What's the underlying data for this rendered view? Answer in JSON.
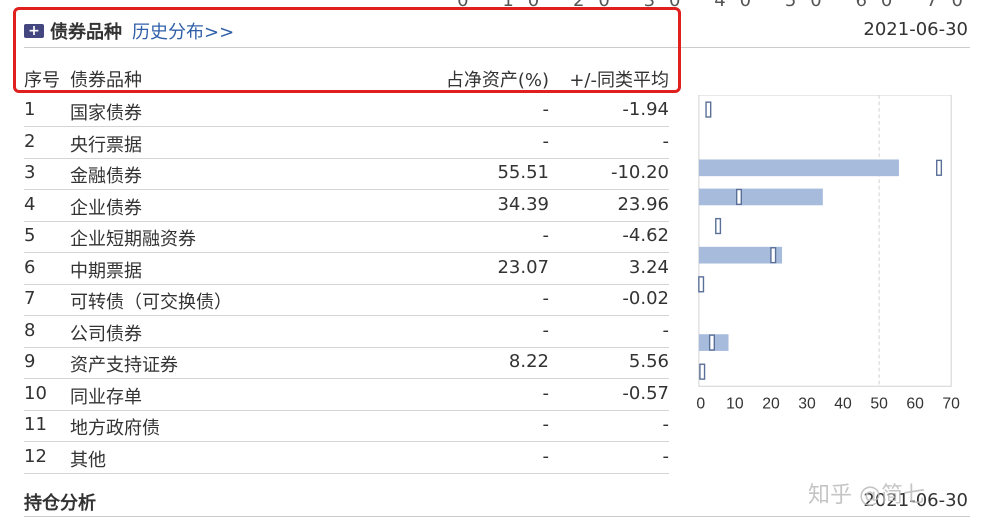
{
  "top_partial": "0 10 20 30 40 50 60 70",
  "section": {
    "title": "债券品种",
    "history_link": "历史分布>>",
    "date": "2021-06-30"
  },
  "columns": {
    "index": "序号",
    "name": "债券品种",
    "pct": "占净资产(%)",
    "avg": "+/-同类平均"
  },
  "rows": [
    {
      "index": "1",
      "name": "国家债券",
      "pct": "-",
      "avg": "-1.94"
    },
    {
      "index": "2",
      "name": "央行票据",
      "pct": "-",
      "avg": "-"
    },
    {
      "index": "3",
      "name": "金融债券",
      "pct": "55.51",
      "avg": "-10.20"
    },
    {
      "index": "4",
      "name": "企业债券",
      "pct": "34.39",
      "avg": "23.96"
    },
    {
      "index": "5",
      "name": "企业短期融资券",
      "pct": "-",
      "avg": "-4.62"
    },
    {
      "index": "6",
      "name": "中期票据",
      "pct": "23.07",
      "avg": "3.24"
    },
    {
      "index": "7",
      "name": "可转债（可交换债）",
      "pct": "-",
      "avg": "-0.02"
    },
    {
      "index": "8",
      "name": "公司债券",
      "pct": "-",
      "avg": "-"
    },
    {
      "index": "9",
      "name": "资产支持证券",
      "pct": "8.22",
      "avg": "5.56"
    },
    {
      "index": "10",
      "name": "同业存单",
      "pct": "-",
      "avg": "-0.57"
    },
    {
      "index": "11",
      "name": "地方政府债",
      "pct": "-",
      "avg": "-"
    },
    {
      "index": "12",
      "name": "其他",
      "pct": "-",
      "avg": "-"
    }
  ],
  "chart_data": {
    "type": "bar",
    "orientation": "horizontal",
    "categories": [
      "国家债券",
      "央行票据",
      "金融债券",
      "企业债券",
      "企业短期融资券",
      "中期票据",
      "可转债（可交换债）",
      "公司债券",
      "资产支持证券",
      "同业存单"
    ],
    "series": [
      {
        "values": [
          0,
          0,
          55.51,
          34.39,
          0,
          23.07,
          0,
          0,
          8.22,
          0
        ]
      }
    ],
    "markers": [
      2.5,
      null,
      66.5,
      11.0,
      5.2,
      20.5,
      0.5,
      null,
      3.5,
      0.8
    ],
    "xlim": [
      0,
      70
    ],
    "xticks": [
      "0",
      "10",
      "20",
      "30",
      "40",
      "50",
      "60",
      "70"
    ],
    "reference_line": 50,
    "colors": {
      "bar": "#a7bcdc",
      "marker_stroke": "#5a6f98"
    }
  },
  "bottom": {
    "title": "持仓分析",
    "date": "2021-06-30"
  },
  "watermark": "知乎 @简七"
}
